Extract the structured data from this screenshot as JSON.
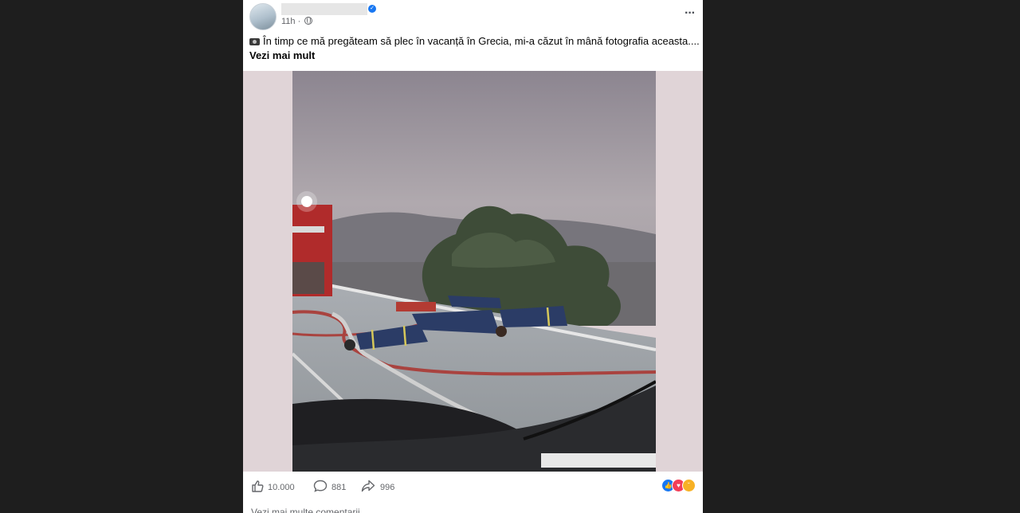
{
  "post": {
    "timestamp": "11h",
    "separator": "·",
    "caption": "În timp ce mă pregăteam să plec în vacanță în Grecia, mi-a căzut în mână fotografia aceasta....",
    "see_more": "Vezi mai mult",
    "likes": "10.000",
    "comments": "881",
    "shares": "996",
    "more_comments": "Vezi mai multe comentarii"
  },
  "icons": {
    "caption_emoji": "camera-icon",
    "privacy": "globe-icon",
    "verified": "verified-badge-icon",
    "like": "thumbs-up-icon",
    "comment": "comment-bubble-icon",
    "share": "share-arrow-icon",
    "reactions": [
      "like-reaction-icon",
      "love-reaction-icon",
      "sad-reaction-icon"
    ]
  },
  "colors": {
    "page_background": "#1e1e1e",
    "card_background": "#ffffff",
    "media_background": "#e0d4d7",
    "secondary_text": "#65676b",
    "accent_blue": "#1877f2",
    "love_red": "#f33e58",
    "sad_yellow": "#f7b125"
  }
}
